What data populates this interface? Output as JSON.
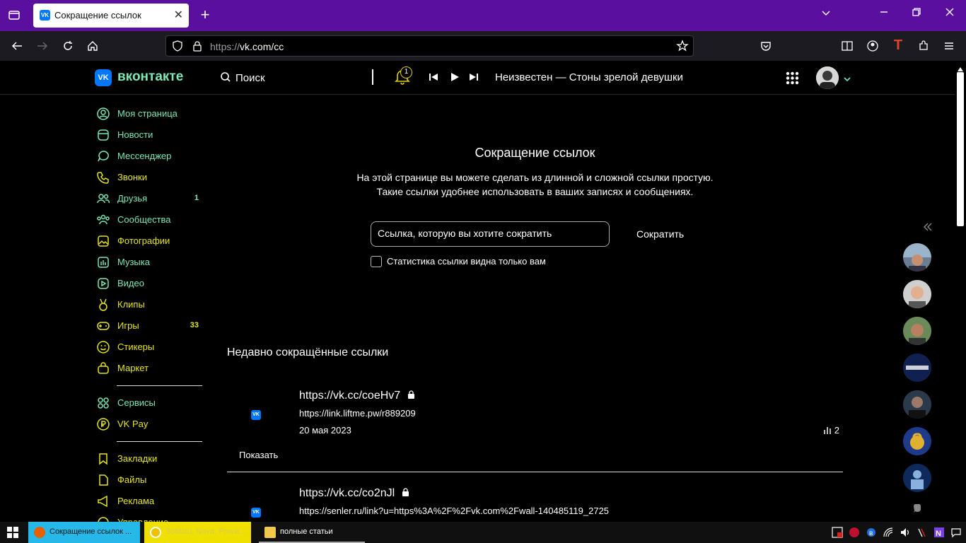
{
  "browser": {
    "tab_title": "Сокращение ссылок",
    "url_prefix": "https://",
    "url_domain": "vk.com/cc",
    "new_tab": "+",
    "close_tab": "✕"
  },
  "header": {
    "logo_text": "вконтакте",
    "logo_mark": "VK",
    "search_label": "Поиск",
    "notifications_count": "1",
    "now_playing": "Неизвестен — Стоны зрелой девушки"
  },
  "sidebar": {
    "items": [
      {
        "label": "Моя страница",
        "color": "#7be8b6",
        "icon": "user-circle-icon"
      },
      {
        "label": "Новости",
        "color": "#7be8b6",
        "icon": "news-icon"
      },
      {
        "label": "Мессенджер",
        "color": "#7be8b6",
        "icon": "message-icon"
      },
      {
        "label": "Звонки",
        "color": "#e6e61a",
        "icon": "phone-icon"
      },
      {
        "label": "Друзья",
        "color": "#7be8b6",
        "icon": "friends-icon",
        "count": "1"
      },
      {
        "label": "Сообщества",
        "color": "#7be8b6",
        "icon": "communities-icon"
      },
      {
        "label": "Фотографии",
        "color": "#e6e61a",
        "icon": "photo-icon"
      },
      {
        "label": "Музыка",
        "color": "#7be8b6",
        "icon": "music-icon"
      },
      {
        "label": "Видео",
        "color": "#7be8b6",
        "icon": "video-icon"
      },
      {
        "label": "Клипы",
        "color": "#e6e61a",
        "icon": "clips-icon"
      },
      {
        "label": "Игры",
        "color": "#e6e61a",
        "icon": "gamepad-icon",
        "count": "33"
      },
      {
        "label": "Стикеры",
        "color": "#e6e61a",
        "icon": "smile-icon"
      },
      {
        "label": "Маркет",
        "color": "#e6e61a",
        "icon": "bag-icon"
      },
      {
        "label": "Сервисы",
        "color": "#7be8b6",
        "icon": "services-icon"
      },
      {
        "label": "VK Pay",
        "color": "#e6e61a",
        "icon": "vkpay-icon"
      },
      {
        "label": "Закладки",
        "color": "#e6e61a",
        "icon": "bookmark-icon"
      },
      {
        "label": "Файлы",
        "color": "#e6e61a",
        "icon": "file-icon"
      },
      {
        "label": "Реклама",
        "color": "#e6e61a",
        "icon": "megaphone-icon"
      },
      {
        "label": "Управление",
        "color": "#e6e61a",
        "icon": "manage-icon"
      }
    ]
  },
  "main": {
    "title": "Сокращение ссылок",
    "description_line1": "На этой странице вы можете сделать из длинной и сложной ссылки простую.",
    "description_line2": "Такие ссылки удобнее использовать в ваших записях и сообщениях.",
    "input_placeholder": "Ссылка, которую вы хотите сократить",
    "shorten_button": "Сократить",
    "checkbox_label": "Статистика ссылки видна только вам",
    "recent_title": "Недавно сокращённые ссылки",
    "links": [
      {
        "short": "https://vk.cc/coeHv7",
        "long": "https://link.liftme.pw/r889209",
        "date": "20 мая 2023",
        "views": "2",
        "show": "Показать"
      },
      {
        "short": "https://vk.cc/co2nJl",
        "long": "https://senler.ru/link?u=https%3A%2F%2Fvk.com%2Fwall-140485119_2725"
      }
    ]
  },
  "taskbar": {
    "items": [
      {
        "label": "Сокращение ссылок ..."
      },
      {
        "label": "Soldatu, Nova, Prova..."
      },
      {
        "label": "полные статьи"
      }
    ]
  },
  "colors": {
    "accent_green": "#7be8b6",
    "accent_yellow": "#e6e61a",
    "tabbar": "#5a0f9e",
    "vk_blue": "#0077ff"
  }
}
